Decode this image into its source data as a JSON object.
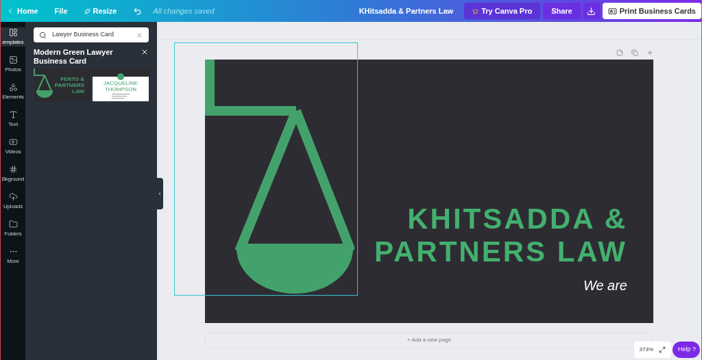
{
  "topbar": {
    "home": "Home",
    "file": "File",
    "resize": "Resize",
    "saved": "All changes saved",
    "title": "KHitsadda & Partners Law",
    "pro": "Try Canva Pro",
    "share": "Share",
    "print": "Print Business Cards"
  },
  "rail": [
    {
      "label": "emplates",
      "selected": true
    },
    {
      "label": "Photos",
      "selected": false
    },
    {
      "label": "Elements",
      "selected": false
    },
    {
      "label": "Text",
      "selected": false
    },
    {
      "label": "Videos",
      "selected": false
    },
    {
      "label": "Bkground",
      "selected": false
    },
    {
      "label": "Uploads",
      "selected": false
    },
    {
      "label": "Folders",
      "selected": false
    },
    {
      "label": "More",
      "selected": false
    }
  ],
  "panel": {
    "search": "Lawyer Business Card",
    "heading": "Modern Green Lawyer Business Card",
    "thumbs": [
      {
        "kind": "dark",
        "text": "FENTO & PARTNERS LAW"
      },
      {
        "kind": "light",
        "text": "JACQUELINE THOMPSON"
      }
    ]
  },
  "card": {
    "title_lines": [
      "KHITSADDA &",
      "PARTNERS LAW"
    ],
    "subtitle": "We are"
  },
  "add_page": "+ Add a new page",
  "zoom": "373%",
  "help": "Help ?"
}
